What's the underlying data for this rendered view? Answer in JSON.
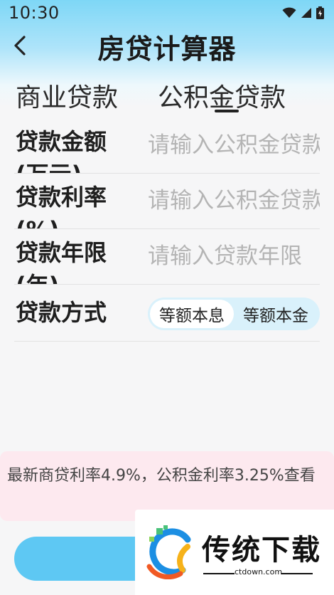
{
  "status_bar": {
    "time": "10:30"
  },
  "header": {
    "title": "房贷计算器",
    "back_icon": "chevron-left-icon"
  },
  "tabs": [
    {
      "label": "商业贷款",
      "active": false
    },
    {
      "label": "公积金贷款",
      "active": true
    }
  ],
  "form": {
    "amount": {
      "label": "贷款金额(万元)",
      "placeholder": "请输入公积金贷款金额"
    },
    "rate": {
      "label": "贷款利率(%)",
      "placeholder": "请输入公积金贷款利率"
    },
    "years": {
      "label": "贷款年限(年)",
      "placeholder": "请输入贷款年限"
    },
    "method": {
      "label": "贷款方式",
      "options": [
        "等额本息",
        "等额本金"
      ],
      "selected": "等额本息"
    }
  },
  "notice": {
    "text": "最新商贷利率4.9%，公积金利率3.25%查看"
  },
  "watermark": {
    "brand": "传统下载",
    "url": "ctdown.com"
  },
  "colors": {
    "accent": "#5ec8f3",
    "notice_bg": "#fde9ef",
    "segment_bg": "#d9f1fb"
  }
}
